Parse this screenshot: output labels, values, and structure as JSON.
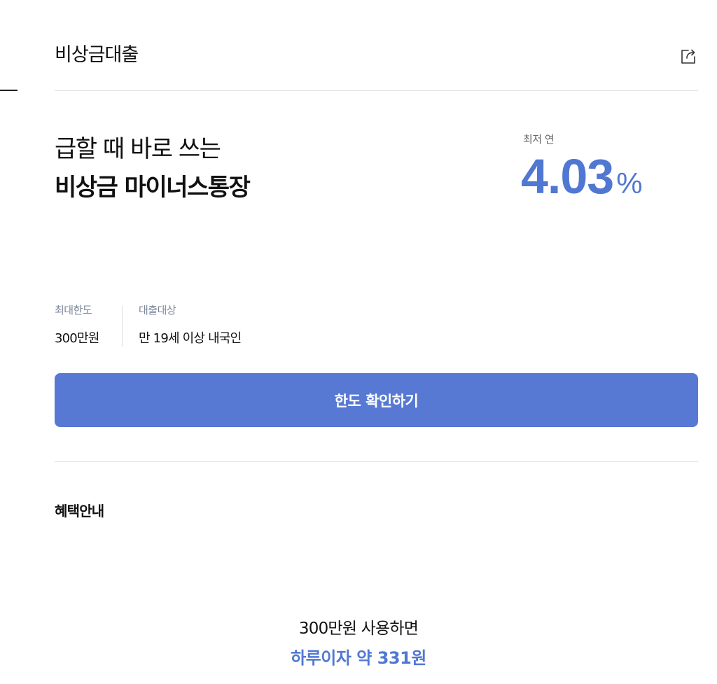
{
  "header": {
    "title": "비상금대출",
    "share_icon": "share-icon"
  },
  "hero": {
    "line1": "급할 때 바로 쓰는",
    "line2": "비상금 마이너스통장"
  },
  "rate": {
    "label": "최저 연",
    "value": "4.03",
    "unit": "%",
    "color": "#5078d2"
  },
  "info": {
    "limit_label": "최대한도",
    "limit_value": "300만원",
    "target_label": "대출대상",
    "target_value": "만 19세 이상 내국인"
  },
  "cta": {
    "label": "한도 확인하기",
    "color": "#5779d3"
  },
  "benefits": {
    "title": "혜택안내"
  },
  "summary": {
    "line1": "300만원 사용하면",
    "line2": "하루이자 약 331원"
  }
}
